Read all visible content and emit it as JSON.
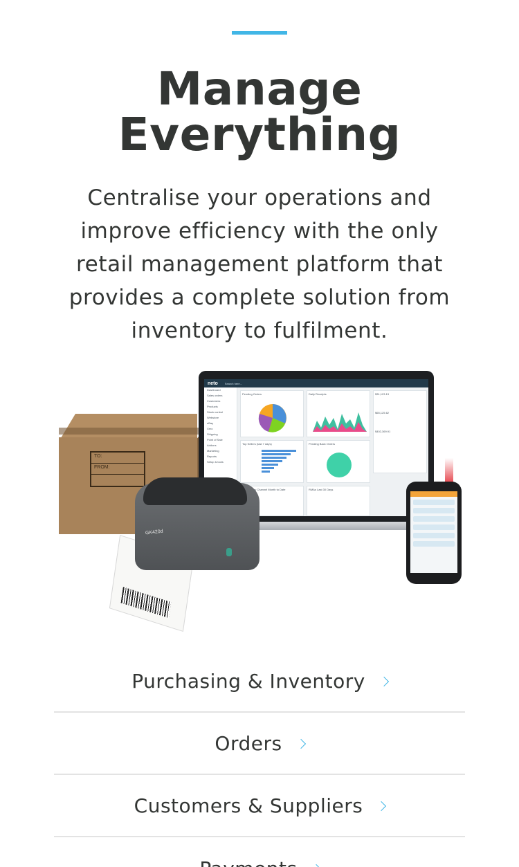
{
  "header": {
    "accent_color": "#41b6e6",
    "title_line1": "Manage",
    "title_line2": "Everything"
  },
  "intro": {
    "text": "Centralise your operations and improve efficiency with the only retail management platform that provides a complete solution from inventory to fulfilment."
  },
  "hero_image": {
    "box_label_to": "TO:",
    "box_label_from": "FROM:",
    "app_logo": "neto",
    "app_search": "Search here...",
    "app_nav": [
      "Dashboard",
      "Sales orders",
      "Customers",
      "Products",
      "Stock control",
      "Webstore",
      "eBay",
      "Xero",
      "Shipping",
      "Point of Sale",
      "Addons",
      "Marketing",
      "Reports",
      "Setup & tools"
    ],
    "panel_titles": [
      "Pending Orders",
      "Daily Receipts",
      "Top Sellers (last 7 days)",
      "Pending Back Orders",
      "Invoiced by Channel Month to Date",
      "RMAs Last 30 Days"
    ],
    "stat_values": [
      "$31,123.13",
      "$65,125.62",
      "$402,369.91"
    ],
    "printer_brand": "GK420d"
  },
  "features": {
    "items": [
      {
        "label": "Purchasing & Inventory"
      },
      {
        "label": "Orders"
      },
      {
        "label": "Customers & Suppliers"
      },
      {
        "label": "Payments"
      }
    ]
  }
}
